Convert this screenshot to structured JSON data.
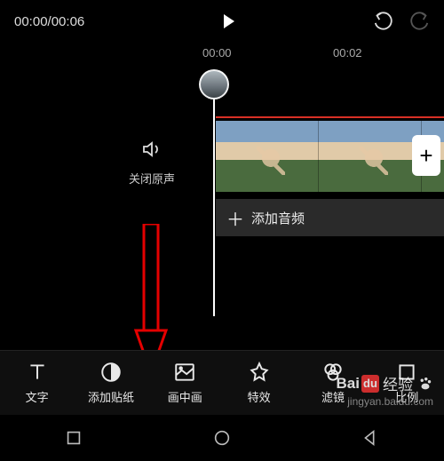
{
  "player": {
    "currentTime": "00:00",
    "duration": "00:06"
  },
  "ruler": {
    "t0": "00:00",
    "t2": "00:02"
  },
  "sideOption": {
    "label": "关闭原声"
  },
  "audio": {
    "addLabel": "添加音频"
  },
  "addClipGlyph": "+",
  "toolbar": {
    "items": [
      {
        "id": "text",
        "label": "文字"
      },
      {
        "id": "sticker",
        "label": "添加贴纸"
      },
      {
        "id": "pip",
        "label": "画中画"
      },
      {
        "id": "effect",
        "label": "特效"
      },
      {
        "id": "filter",
        "label": "滤镜"
      },
      {
        "id": "ratio",
        "label": "比例"
      }
    ]
  },
  "watermark": {
    "bai": "Bai",
    "du": "du",
    "jy": "经验",
    "url": "jingyan.baidu.com"
  }
}
